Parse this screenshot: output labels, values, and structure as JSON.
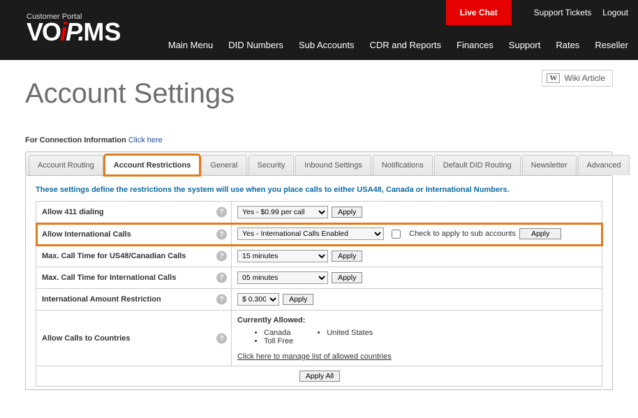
{
  "topbar": {
    "live_chat": "Live Chat",
    "support_tickets": "Support Tickets",
    "logout": "Logout",
    "customer_portal": "Customer Portal"
  },
  "nav": {
    "items": [
      "Main Menu",
      "DID Numbers",
      "Sub Accounts",
      "CDR and Reports",
      "Finances",
      "Support",
      "Rates",
      "Reseller"
    ]
  },
  "page_title": "Account Settings",
  "wiki_label": "Wiki Article",
  "conn_info_prefix": "For Connection Information ",
  "conn_info_link": "Click here",
  "tabs": [
    "Account Routing",
    "Account Restrictions",
    "General",
    "Security",
    "Inbound Settings",
    "Notifications",
    "Default DID Routing",
    "Newsletter",
    "Advanced"
  ],
  "active_tab_index": 1,
  "highlight_tab_index": 1,
  "intro_text": "These settings define the restrictions the system will use when you place calls to either USA48, Canada or International Numbers.",
  "rows": {
    "allow411": {
      "label": "Allow 411 dialing",
      "select_value": "Yes - $0.99 per call",
      "apply": "Apply"
    },
    "allow_intl": {
      "label": "Allow International Calls",
      "select_value": "Yes - International Calls Enabled",
      "checkbox_label": "Check to apply to sub accounts",
      "apply": "Apply"
    },
    "max_us48": {
      "label": "Max. Call Time for US48/Canadian Calls",
      "select_value": "15 minutes",
      "apply": "Apply"
    },
    "max_intl": {
      "label": "Max. Call Time for International Calls",
      "select_value": "05 minutes",
      "apply": "Apply"
    },
    "intl_amount": {
      "label": "International Amount Restriction",
      "select_value": "$ 0.300",
      "apply": "Apply"
    },
    "countries": {
      "label": "Allow Calls to Countries",
      "heading": "Currently Allowed:",
      "col1": [
        "Canada",
        "Toll Free"
      ],
      "col2": [
        "United States"
      ],
      "manage_link": "Click here to manage list of allowed countries"
    }
  },
  "apply_all": "Apply All"
}
